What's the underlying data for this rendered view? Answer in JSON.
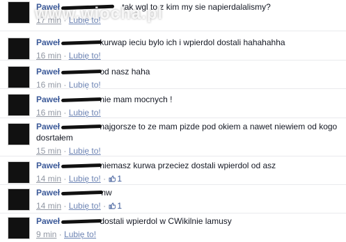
{
  "watermark": "www.wiocha.pl",
  "comments": [
    {
      "author": "Paweł",
      "text": "tak wgl to z kim my sie napierdalalismy?",
      "time": "17 min",
      "like": "Lubię to!",
      "likes": ""
    },
    {
      "author": "Paweł",
      "text": "kurwap ieciu bylo ich i wpierdol dostali hahahahha",
      "time": "16 min",
      "like": "Lubię to!",
      "likes": ""
    },
    {
      "author": "Paweł",
      "text": "od nasz haha",
      "time": "16 min",
      "like": "Lubię to!",
      "likes": ""
    },
    {
      "author": "Paweł",
      "text": "nie mam mocnych !",
      "time": "16 min",
      "like": "Lubię to!",
      "likes": ""
    },
    {
      "author": "Paweł",
      "text": "najgorsze to ze mam pizde pod okiem a nawet niewiem od kogo dosrtałem",
      "time": "15 min",
      "like": "Lubię to!",
      "likes": ""
    },
    {
      "author": "Paweł",
      "text": "niemasz kurwa przeciez dostali wpierdol od asz",
      "time": "14 min",
      "like": "Lubię to!",
      "likes": "1"
    },
    {
      "author": "Paweł",
      "text": "nw",
      "time": "14 min",
      "like": "Lubię to!",
      "likes": "1"
    },
    {
      "author": "Paweł",
      "text": "dostali wpierdol w CWikilnie lamusy",
      "time": "9 min",
      "like": "Lubię to!",
      "likes": ""
    }
  ]
}
